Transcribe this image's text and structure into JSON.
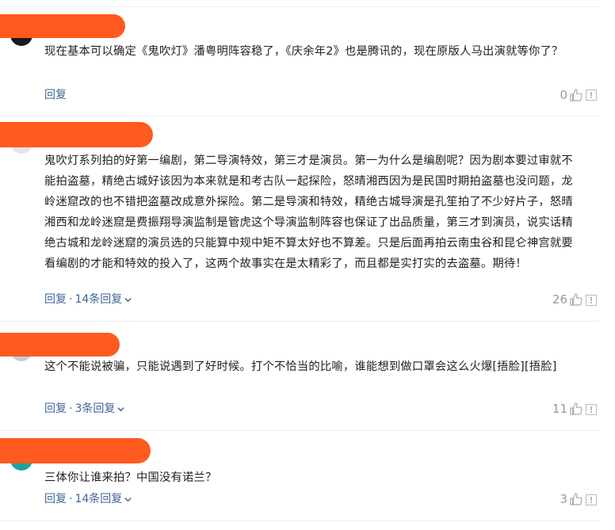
{
  "comments": [
    {
      "text": "现在基本可以确定《鬼吹灯》潘粤明阵容稳了，《庆余年2》也是腾讯的，现在原版人马出演就等你了？",
      "reply_label": "回复",
      "likes": "0",
      "avatar_color": "#1a1a1a"
    },
    {
      "text": "鬼吹灯系列拍的好第一编剧，第二导演特效，第三才是演员。第一为什么是编剧呢？因为剧本要过审就不能拍盗墓，精绝古城好该因为本来就是和考古队一起探险，怒晴湘西因为是民国时期拍盗墓也没问题，龙岭迷窟改的也不错把盗墓改成意外探险。第二是导演和特效，精绝古城导演是孔笙拍了不少好片子，怒晴湘西和龙岭迷窟是费振翔导演监制是管虎这个导演监制阵容也保证了出品质量，第三才到演员，说实话精绝古城和龙岭迷窟的演员选的只能算中规中矩不算太好也不算差。只是后面再拍云南虫谷和昆仑神宫就要看编剧的才能和特效的投入了，这两个故事实在是太精彩了，而且都是实打实的去盗墓。期待！",
      "reply_label": "回复",
      "replies_label": "14条回复",
      "likes": "26",
      "avatar_color": "#e3e3e8"
    },
    {
      "text": "这个不能说被骗，只能说遇到了好时候。打个不恰当的比喻，谁能想到做口罩会这么火爆[捂脸][捂脸]",
      "reply_label": "回复",
      "replies_label": "3条回复",
      "likes": "11",
      "avatar_color": "#c9ccd4"
    },
    {
      "text": "三体你让谁来拍？中国没有诺兰？",
      "reply_label": "回复",
      "replies_label": "14条回复",
      "likes": "3",
      "avatar_color": "#1aa3a3"
    }
  ],
  "separator": "·",
  "colors": {
    "link": "#406599",
    "redaction": "#ff5a1f",
    "muted": "#999999"
  },
  "icons": {
    "like": "thumbs-up-icon",
    "report": "report-icon",
    "expand": "chevron-down-icon"
  }
}
